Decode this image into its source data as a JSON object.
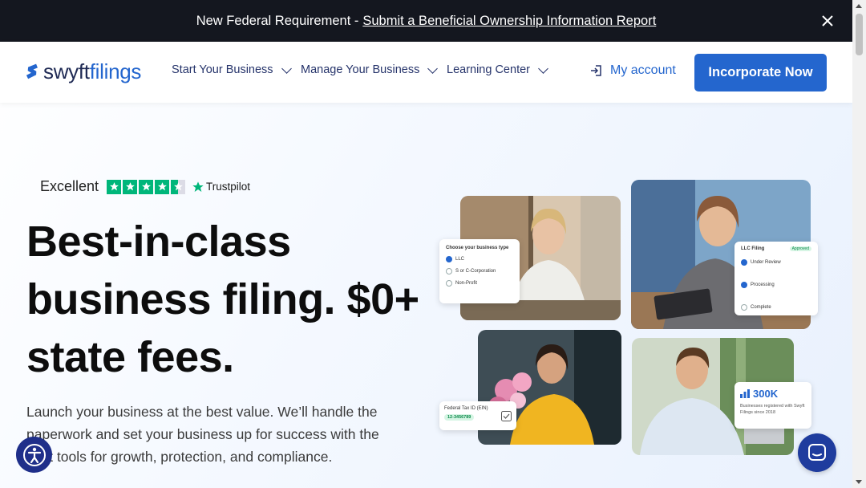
{
  "announcement": {
    "prefix": "New Federal Requirement -",
    "link": "Submit a Beneficial Ownership Information Report"
  },
  "nav": {
    "logo_a": "swyft",
    "logo_b": "filings",
    "items": [
      "Start Your Business",
      "Manage Your Business",
      "Learning Center"
    ],
    "account": "My account",
    "cta": "Incorporate Now"
  },
  "trust": {
    "rating": "Excellent",
    "brand": "Trustpilot",
    "stars": 4.5
  },
  "hero": {
    "headline": "Best-in-class business filing. $0+ state fees.",
    "subtext": "Launch your business at the best value. We’ll handle the paperwork and set your business up for success with the best tools for growth, protection, and compliance."
  },
  "collage": {
    "business_type_card": {
      "title": "Choose your business type",
      "options": [
        "LLC",
        "S or C-Corporation",
        "Non-Profit"
      ]
    },
    "llc_card": {
      "title": "LLC Filing",
      "badge": "Approved",
      "steps": [
        "Under Review",
        "Processing",
        "Complete"
      ]
    },
    "tax_card": {
      "title": "Federal Tax ID (EIN)",
      "value": "12-3456789"
    },
    "stat_card": {
      "value": "300K",
      "caption": "Businesses registered with Swyft Filings since 2018"
    }
  },
  "colors": {
    "brand_blue": "#2466ce",
    "navy": "#1f2a54",
    "announcement_bg": "#14171f",
    "trustpilot_green": "#00b67a"
  }
}
